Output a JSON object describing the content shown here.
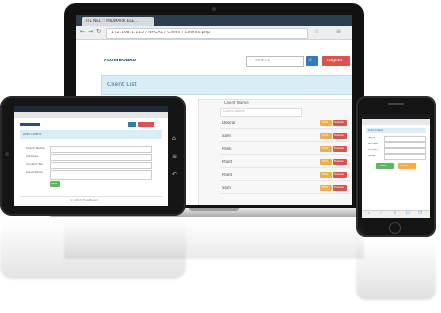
{
  "laptop": {
    "tab_title": "TFL NEL :: MIDMARK ELE...",
    "address": "172.168.1.115 / NFCAL / Client / Clients.php",
    "brand": "FLOWBOARD",
    "search_placeholder": "Search",
    "logout_label": "Logout",
    "page_title": "Client List",
    "col_header": "Client Name",
    "filter_placeholder": "Client Name",
    "rows": [
      "Dooral",
      "Sam",
      "Pank",
      "Plant",
      "Plant",
      "Sam"
    ],
    "edit_label": "Edit",
    "delete_label": "Delete"
  },
  "tablet": {
    "page_title": "Add Client",
    "form_labels": [
      "Client Name",
      "Address",
      "Contact No",
      "Description"
    ],
    "save_label": "Save",
    "footer": "© 2013 FlowBoard"
  },
  "phone": {
    "form_title": "Add Client",
    "form_labels": [
      "Name",
      "Address",
      "Contact",
      "Notes"
    ],
    "save_label": "Save",
    "cancel_label": "Cancel"
  },
  "colors": {
    "header_band": "#d9edf7",
    "primary": "#337ab7",
    "danger": "#d9534f",
    "warning": "#f0ad4e",
    "success": "#5cb85c"
  }
}
